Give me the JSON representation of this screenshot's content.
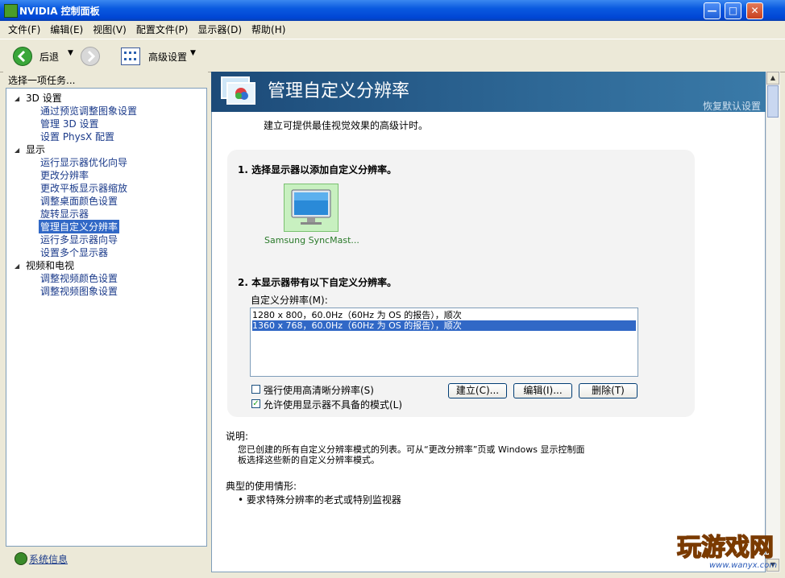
{
  "window": {
    "title": "NVIDIA 控制面板",
    "min_glyph": "—",
    "max_glyph": "□",
    "close_glyph": "✕"
  },
  "menu": [
    "文件(F)",
    "编辑(E)",
    "视图(V)",
    "配置文件(P)",
    "显示器(D)",
    "帮助(H)"
  ],
  "toolbar": {
    "back_label": "后退",
    "advanced_label": "高级设置"
  },
  "task_header": "选择一项任务...",
  "tree": {
    "cat_3d": "3D 设置",
    "item_3d_1": "通过预览调整图象设置",
    "item_3d_2": "管理 3D 设置",
    "item_3d_3": "设置 PhysX 配置",
    "cat_display": "显示",
    "item_d_1": "运行显示器优化向导",
    "item_d_2": "更改分辨率",
    "item_d_3": "更改平板显示器缩放",
    "item_d_4": "调整桌面颜色设置",
    "item_d_5": "旋转显示器",
    "item_d_6": "管理自定义分辨率",
    "item_d_7": "运行多显示器向导",
    "item_d_8": "设置多个显示器",
    "cat_video": "视频和电视",
    "item_v_1": "调整视频颜色设置",
    "item_v_2": "调整视频图象设置"
  },
  "system_info": "系统信息",
  "page": {
    "title": "管理自定义分辨率",
    "restore_defaults": "恢复默认设置",
    "intro": "建立可提供最佳视觉效果的高级计时。",
    "step1": "1. 选择显示器以添加自定义分辨率。",
    "monitor_label": "Samsung SyncMast...",
    "step2": "2. 本显示器带有以下自定义分辨率。",
    "list_label": "自定义分辨率(M):",
    "resolutions": [
      "1280 x 800，60.0Hz（60Hz 为 OS 的报告），顺次",
      "1360 x 768，60.0Hz（60Hz 为 OS 的报告），顺次"
    ],
    "check_hd": "强行使用高清晰分辨率(S)",
    "check_allow": "允许使用显示器不具备的模式(L)",
    "btn_create": "建立(C)...",
    "btn_edit": "编辑(I)...",
    "btn_delete": "删除(T)",
    "desc_title": "说明:",
    "desc_line1": "您已创建的所有自定义分辨率模式的列表。可从“更改分辨率”页或 Windows 显示控制面",
    "desc_line2": "板选择这些新的自定义分辨率模式。",
    "usage_title": "典型的使用情形:",
    "usage_item": "• 要求特殊分辨率的老式或特别监视器"
  },
  "watermark": {
    "text": "玩游戏网",
    "url": "www.wanyx.com"
  },
  "colors": {
    "banner": "#2e6896",
    "selection": "#3168c6",
    "link": "#1a3a8a",
    "titlebar": "#0046d5"
  }
}
